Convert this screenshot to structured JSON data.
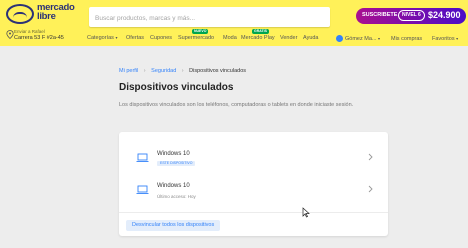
{
  "header": {
    "logo_text": "mercado libre",
    "search": {
      "placeholder": "Buscar productos, marcas y más..."
    },
    "promo": {
      "text": "SUSCRIBETE",
      "level": "NIVEL 6",
      "price": "$24.900"
    },
    "location": {
      "label": "Enviar a Rafael",
      "value": "Carrera 53 F #2a-45"
    },
    "nav": [
      {
        "label": "Categorías",
        "caret": true
      },
      {
        "label": "Ofertas"
      },
      {
        "label": "Cupones"
      },
      {
        "label": "Supermercado",
        "badge": "NUEVO"
      },
      {
        "label": "Moda"
      },
      {
        "label": "Mercado Play",
        "badge": "GRATIS"
      },
      {
        "label": "Vender"
      },
      {
        "label": "Ayuda"
      }
    ],
    "user_name": "Gómez Ma...",
    "my_purchases": "Mis compras",
    "favorites": "Favoritos"
  },
  "breadcrumb": [
    {
      "label": "Mi perfil"
    },
    {
      "label": "Seguridad"
    },
    {
      "label": "Dispositivos vinculados"
    }
  ],
  "page": {
    "title": "Dispositivos vinculados",
    "description": "Los dispositivos vinculados son los teléfonos, computadoras o tablets en donde iniciaste sesión."
  },
  "devices": [
    {
      "name": "Windows 10",
      "badge": "ESTE DISPOSITIVO",
      "meta": ""
    },
    {
      "name": "Windows 10",
      "badge": "",
      "meta": "Último acceso: Hoy"
    }
  ],
  "unlink_all_label": "Desvincular todos los dispositivos",
  "colors": {
    "header_bg": "#fff159",
    "accent_blue": "#3483fa",
    "brand_navy": "#2d3277",
    "page_bg": "#ededed"
  }
}
